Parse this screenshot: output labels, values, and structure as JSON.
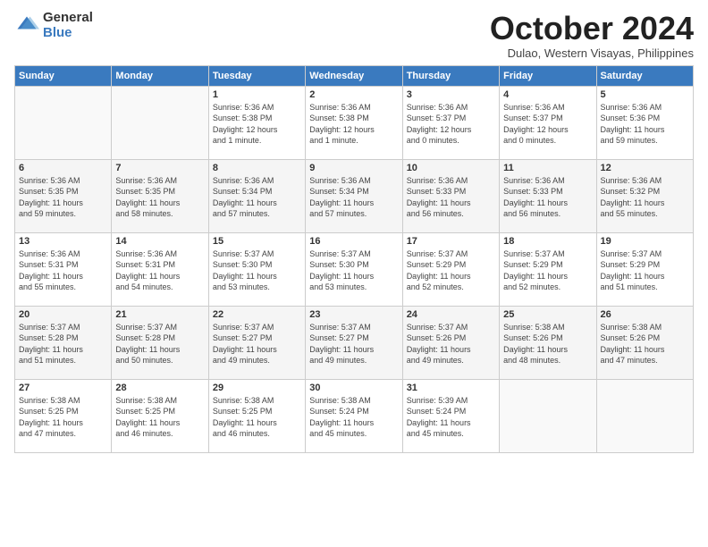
{
  "logo": {
    "general": "General",
    "blue": "Blue"
  },
  "title": "October 2024",
  "subtitle": "Dulao, Western Visayas, Philippines",
  "days_of_week": [
    "Sunday",
    "Monday",
    "Tuesday",
    "Wednesday",
    "Thursday",
    "Friday",
    "Saturday"
  ],
  "weeks": [
    [
      {
        "day": "",
        "info": ""
      },
      {
        "day": "",
        "info": ""
      },
      {
        "day": "1",
        "info": "Sunrise: 5:36 AM\nSunset: 5:38 PM\nDaylight: 12 hours\nand 1 minute."
      },
      {
        "day": "2",
        "info": "Sunrise: 5:36 AM\nSunset: 5:38 PM\nDaylight: 12 hours\nand 1 minute."
      },
      {
        "day": "3",
        "info": "Sunrise: 5:36 AM\nSunset: 5:37 PM\nDaylight: 12 hours\nand 0 minutes."
      },
      {
        "day": "4",
        "info": "Sunrise: 5:36 AM\nSunset: 5:37 PM\nDaylight: 12 hours\nand 0 minutes."
      },
      {
        "day": "5",
        "info": "Sunrise: 5:36 AM\nSunset: 5:36 PM\nDaylight: 11 hours\nand 59 minutes."
      }
    ],
    [
      {
        "day": "6",
        "info": "Sunrise: 5:36 AM\nSunset: 5:35 PM\nDaylight: 11 hours\nand 59 minutes."
      },
      {
        "day": "7",
        "info": "Sunrise: 5:36 AM\nSunset: 5:35 PM\nDaylight: 11 hours\nand 58 minutes."
      },
      {
        "day": "8",
        "info": "Sunrise: 5:36 AM\nSunset: 5:34 PM\nDaylight: 11 hours\nand 57 minutes."
      },
      {
        "day": "9",
        "info": "Sunrise: 5:36 AM\nSunset: 5:34 PM\nDaylight: 11 hours\nand 57 minutes."
      },
      {
        "day": "10",
        "info": "Sunrise: 5:36 AM\nSunset: 5:33 PM\nDaylight: 11 hours\nand 56 minutes."
      },
      {
        "day": "11",
        "info": "Sunrise: 5:36 AM\nSunset: 5:33 PM\nDaylight: 11 hours\nand 56 minutes."
      },
      {
        "day": "12",
        "info": "Sunrise: 5:36 AM\nSunset: 5:32 PM\nDaylight: 11 hours\nand 55 minutes."
      }
    ],
    [
      {
        "day": "13",
        "info": "Sunrise: 5:36 AM\nSunset: 5:31 PM\nDaylight: 11 hours\nand 55 minutes."
      },
      {
        "day": "14",
        "info": "Sunrise: 5:36 AM\nSunset: 5:31 PM\nDaylight: 11 hours\nand 54 minutes."
      },
      {
        "day": "15",
        "info": "Sunrise: 5:37 AM\nSunset: 5:30 PM\nDaylight: 11 hours\nand 53 minutes."
      },
      {
        "day": "16",
        "info": "Sunrise: 5:37 AM\nSunset: 5:30 PM\nDaylight: 11 hours\nand 53 minutes."
      },
      {
        "day": "17",
        "info": "Sunrise: 5:37 AM\nSunset: 5:29 PM\nDaylight: 11 hours\nand 52 minutes."
      },
      {
        "day": "18",
        "info": "Sunrise: 5:37 AM\nSunset: 5:29 PM\nDaylight: 11 hours\nand 52 minutes."
      },
      {
        "day": "19",
        "info": "Sunrise: 5:37 AM\nSunset: 5:29 PM\nDaylight: 11 hours\nand 51 minutes."
      }
    ],
    [
      {
        "day": "20",
        "info": "Sunrise: 5:37 AM\nSunset: 5:28 PM\nDaylight: 11 hours\nand 51 minutes."
      },
      {
        "day": "21",
        "info": "Sunrise: 5:37 AM\nSunset: 5:28 PM\nDaylight: 11 hours\nand 50 minutes."
      },
      {
        "day": "22",
        "info": "Sunrise: 5:37 AM\nSunset: 5:27 PM\nDaylight: 11 hours\nand 49 minutes."
      },
      {
        "day": "23",
        "info": "Sunrise: 5:37 AM\nSunset: 5:27 PM\nDaylight: 11 hours\nand 49 minutes."
      },
      {
        "day": "24",
        "info": "Sunrise: 5:37 AM\nSunset: 5:26 PM\nDaylight: 11 hours\nand 49 minutes."
      },
      {
        "day": "25",
        "info": "Sunrise: 5:38 AM\nSunset: 5:26 PM\nDaylight: 11 hours\nand 48 minutes."
      },
      {
        "day": "26",
        "info": "Sunrise: 5:38 AM\nSunset: 5:26 PM\nDaylight: 11 hours\nand 47 minutes."
      }
    ],
    [
      {
        "day": "27",
        "info": "Sunrise: 5:38 AM\nSunset: 5:25 PM\nDaylight: 11 hours\nand 47 minutes."
      },
      {
        "day": "28",
        "info": "Sunrise: 5:38 AM\nSunset: 5:25 PM\nDaylight: 11 hours\nand 46 minutes."
      },
      {
        "day": "29",
        "info": "Sunrise: 5:38 AM\nSunset: 5:25 PM\nDaylight: 11 hours\nand 46 minutes."
      },
      {
        "day": "30",
        "info": "Sunrise: 5:38 AM\nSunset: 5:24 PM\nDaylight: 11 hours\nand 45 minutes."
      },
      {
        "day": "31",
        "info": "Sunrise: 5:39 AM\nSunset: 5:24 PM\nDaylight: 11 hours\nand 45 minutes."
      },
      {
        "day": "",
        "info": ""
      },
      {
        "day": "",
        "info": ""
      }
    ]
  ]
}
